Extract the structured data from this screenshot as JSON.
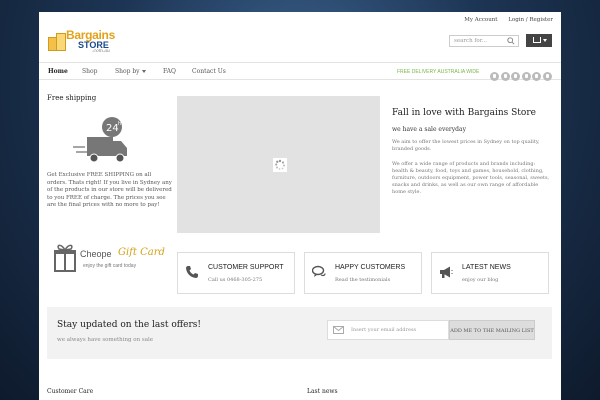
{
  "topbar": {
    "my_account": "My Account",
    "login": "Login / Register"
  },
  "logo": {
    "word1": "Bargains",
    "word2": "STORE",
    "word3": ".com.au"
  },
  "search": {
    "placeholder": "search for..."
  },
  "nav": {
    "items": [
      "Home",
      "Shop",
      "Shop by",
      "FAQ",
      "Contact Us"
    ],
    "delivery": "FREE DELIVERY AUSTRALIA WIDE"
  },
  "social_icons": [
    "facebook-icon",
    "twitter-icon",
    "rss-icon",
    "google-plus-icon",
    "linkedin-icon",
    "pinterest-icon"
  ],
  "free_shipping": {
    "title": "Free shipping",
    "badge": "24",
    "badge_sup": "h",
    "text": "Get Exclusive FREE SHIPPING on all orders. Thats right! If you live in Sydney any of the products in our store will be delivered to you FREE of charge. The prices you see are the final prices with no more to pay!"
  },
  "welcome": {
    "title": "Fall in love with Bargains Store",
    "subtitle": "we have a sale everyday",
    "p1": "We aim to offer the lowest prices in Sydney on top quality, branded goods.",
    "p2": "We offer a wide range of products and brands including: health & beauty, food, toys and games, household, clothing, furniture, outdoors equipment, power tools, seasonal, sweets, snacks and drinks, as well as our own range of affordable home style."
  },
  "gift": {
    "word1": "Cheope",
    "word2": "Gift Card",
    "sub": "enjoy the gift card today"
  },
  "features": [
    {
      "title": "CUSTOMER SUPPORT",
      "sub": "Call us 0468-305-275",
      "icon": "phone-icon"
    },
    {
      "title": "HAPPY CUSTOMERS",
      "sub": "Read the testimonials",
      "icon": "chat-icon"
    },
    {
      "title": "LATEST NEWS",
      "sub": "enjoy our blog",
      "icon": "megaphone-icon"
    }
  ],
  "newsletter": {
    "title": "Stay updated on the last offers!",
    "subtitle": "we always have something on sale",
    "placeholder": "Insert your email address",
    "button": "ADD ME TO THE MAILING LIST"
  },
  "footer": {
    "col1": "Customer Care",
    "col2": "Last news"
  },
  "colors": {
    "accent": "#e2a21a",
    "delivery_green": "#7ab648",
    "logo_blue": "#1a4a8c"
  }
}
